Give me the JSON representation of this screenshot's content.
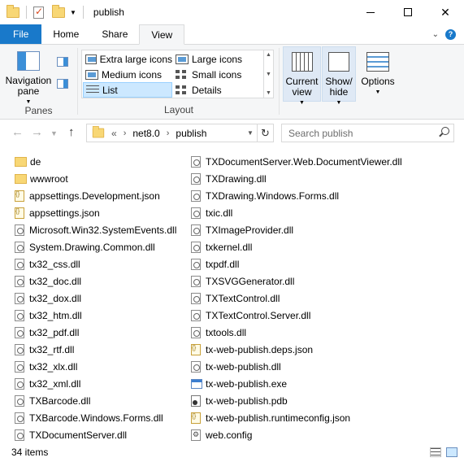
{
  "window": {
    "title": "publish",
    "controls": {
      "minimize": "",
      "maximize": "",
      "close": "✕"
    }
  },
  "tabs": {
    "file": "File",
    "home": "Home",
    "share": "Share",
    "view": "View",
    "help": "?"
  },
  "ribbon": {
    "panes": {
      "label": "Panes",
      "navigation_pane": "Navigation pane"
    },
    "layout": {
      "label": "Layout",
      "items": [
        "Extra large icons",
        "Large icons",
        "Medium icons",
        "Small icons",
        "List",
        "Details"
      ],
      "selected": "List"
    },
    "current_view": "Current view",
    "show_hide": "Show/ hide",
    "options": "Options"
  },
  "address": {
    "prefix": "«",
    "segments": [
      "net8.0",
      "publish"
    ],
    "search_placeholder": "Search publish"
  },
  "files": {
    "column1": [
      {
        "name": "de",
        "type": "folder"
      },
      {
        "name": "wwwroot",
        "type": "folder"
      },
      {
        "name": "appsettings.Development.json",
        "type": "json"
      },
      {
        "name": "appsettings.json",
        "type": "json"
      },
      {
        "name": "Microsoft.Win32.SystemEvents.dll",
        "type": "dll"
      },
      {
        "name": "System.Drawing.Common.dll",
        "type": "dll"
      },
      {
        "name": "tx32_css.dll",
        "type": "dll"
      },
      {
        "name": "tx32_doc.dll",
        "type": "dll"
      },
      {
        "name": "tx32_dox.dll",
        "type": "dll"
      },
      {
        "name": "tx32_htm.dll",
        "type": "dll"
      },
      {
        "name": "tx32_pdf.dll",
        "type": "dll"
      },
      {
        "name": "tx32_rtf.dll",
        "type": "dll"
      },
      {
        "name": "tx32_xlx.dll",
        "type": "dll"
      },
      {
        "name": "tx32_xml.dll",
        "type": "dll"
      },
      {
        "name": "TXBarcode.dll",
        "type": "dll"
      },
      {
        "name": "TXBarcode.Windows.Forms.dll",
        "type": "dll"
      },
      {
        "name": "TXDocumentServer.dll",
        "type": "dll"
      }
    ],
    "column2": [
      {
        "name": "TXDocumentServer.Web.DocumentViewer.dll",
        "type": "dll"
      },
      {
        "name": "TXDrawing.dll",
        "type": "dll"
      },
      {
        "name": "TXDrawing.Windows.Forms.dll",
        "type": "dll"
      },
      {
        "name": "txic.dll",
        "type": "dll"
      },
      {
        "name": "TXImageProvider.dll",
        "type": "dll"
      },
      {
        "name": "txkernel.dll",
        "type": "dll"
      },
      {
        "name": "txpdf.dll",
        "type": "dll"
      },
      {
        "name": "TXSVGGenerator.dll",
        "type": "dll"
      },
      {
        "name": "TXTextControl.dll",
        "type": "dll"
      },
      {
        "name": "TXTextControl.Server.dll",
        "type": "dll"
      },
      {
        "name": "txtools.dll",
        "type": "dll"
      },
      {
        "name": "tx-web-publish.deps.json",
        "type": "json"
      },
      {
        "name": "tx-web-publish.dll",
        "type": "dll"
      },
      {
        "name": "tx-web-publish.exe",
        "type": "exe"
      },
      {
        "name": "tx-web-publish.pdb",
        "type": "pdb"
      },
      {
        "name": "tx-web-publish.runtimeconfig.json",
        "type": "json"
      },
      {
        "name": "web.config",
        "type": "config"
      }
    ]
  },
  "status": {
    "item_count": "34 items"
  }
}
